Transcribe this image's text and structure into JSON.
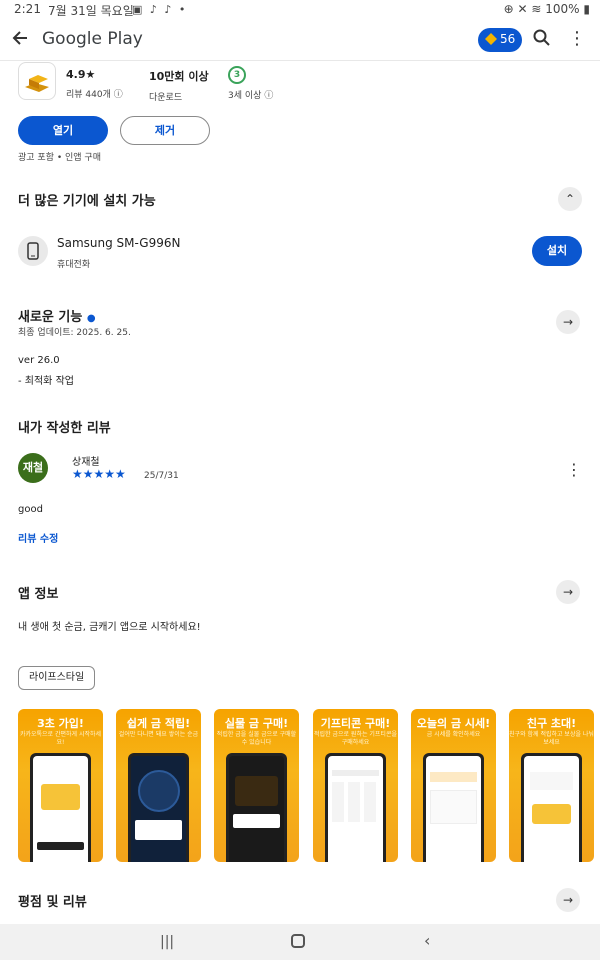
{
  "status_bar": {
    "time": "2:21",
    "date": "7월 31일 목요일",
    "system": "100%"
  },
  "appbar": {
    "title": "Google Play",
    "points": "56"
  },
  "app_stats": {
    "rating_value": "4.9★",
    "rating_label": "리뷰 440개",
    "downloads_value": "10만회 이상",
    "downloads_label": "다운로드",
    "age_badge": "3",
    "age_label": "3세 이상"
  },
  "actions": {
    "open_label": "열기",
    "remove_label": "제거",
    "ads_note": "광고 포함 • 인앱 구매"
  },
  "install_more": {
    "title": "더 많은 기기에 설치 가능",
    "device_name": "Samsung SM-G996N",
    "device_type": "휴대전화",
    "install_label": "설치"
  },
  "whats_new": {
    "title": "새로운 기능",
    "updated": "최종 업데이트: 2025. 6. 25.",
    "version": "ver 26.0",
    "notes": "- 최적화 작업"
  },
  "my_review": {
    "title": "내가 작성한 리뷰",
    "avatar_text": "재철",
    "author": "상재철",
    "stars": "★★★★★",
    "date": "25/7/31",
    "text": "good",
    "edit_label": "리뷰 수정"
  },
  "app_info": {
    "title": "앱 정보",
    "description": "내 생애 첫 순금, 금캐기 앱으로 시작하세요!",
    "category_chip": "라이프스타일"
  },
  "screenshots": [
    {
      "caption": "3초 가입!",
      "sub": "카카오톡으로 간편하게 시작하세요!"
    },
    {
      "caption": "쉽게 금 적립!",
      "sub": "걸어만 다니면 돼요 쌓이는 순금"
    },
    {
      "caption": "실물 금 구매!",
      "sub": "적립한 금을 실물 금으로 구매할 수 있습니다"
    },
    {
      "caption": "기프티콘 구매!",
      "sub": "적립한 금으로 원하는 기프티콘을 구매하세요"
    },
    {
      "caption": "오늘의 금 시세!",
      "sub": "금 시세를 확인하세요"
    },
    {
      "caption": "친구 초대!",
      "sub": "친구와 함께 적립하고 보상을 나눠보세요"
    }
  ],
  "ratings": {
    "title": "평점 및 리뷰"
  },
  "colors": {
    "accent": "#0b57d0",
    "screenshot_bg": "#f6a300",
    "avatar_bg": "#3b6e1b"
  }
}
